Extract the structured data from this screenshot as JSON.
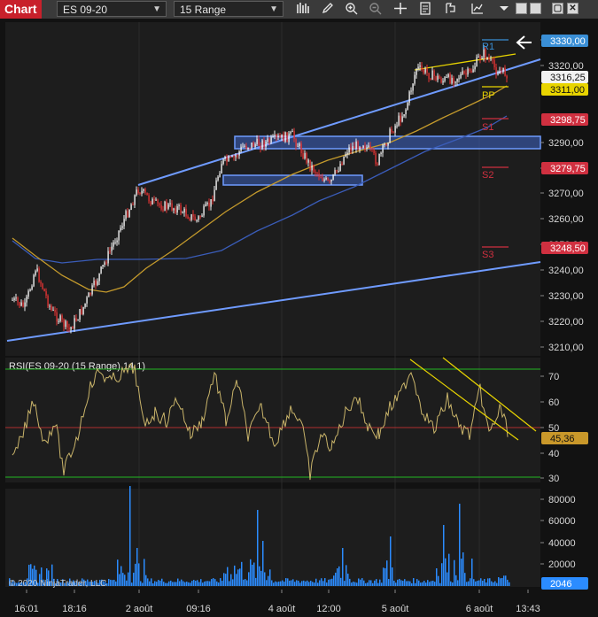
{
  "toolbar": {
    "title": "Chart",
    "instrument": "ES 09-20",
    "interval": "15 Range",
    "icons": [
      "bars-icon",
      "draw-pencil-icon",
      "zoom-in-icon",
      "zoom-out-icon",
      "crosshair-icon",
      "properties-icon",
      "strategy-icon",
      "indicator-icon",
      "menu-dropdown-icon",
      "window-minimize-icon",
      "window-restore-icon",
      "window-maximize-icon",
      "window-close-icon"
    ]
  },
  "price_panel": {
    "axis_ticks": [
      "3330,00",
      "3320,00",
      "3290,00",
      "3280,00",
      "3270,00",
      "3260,00",
      "3250,00",
      "3240,00",
      "3230,00",
      "3220,00",
      "3210,00"
    ],
    "badges": {
      "r1": "3330,00",
      "last": "3316,25",
      "pp": "3311,00",
      "s1": "3298,75",
      "s2": "3279,75",
      "s3": "3248,50"
    },
    "pivot_labels": {
      "r1": "R1",
      "pp": "PP",
      "s1": "S1",
      "s2": "S2",
      "s3": "S3"
    },
    "colors": {
      "candle_up": "#f0f0f0",
      "candle_down": "#e23434",
      "ma_slow": "#3a5cb8",
      "ma_fast": "#c49a2c",
      "trendline": "#6f9bff",
      "zone": "#3e65c7",
      "pivot_r": "#3a8fd6",
      "pivot_pp": "#e8d400",
      "pivot_s": "#d03040"
    }
  },
  "rsi_panel": {
    "label": "RSI(ES 09-20 (15 Range),14,1)",
    "axis_ticks": [
      "70",
      "60",
      "50",
      "40",
      "30"
    ],
    "badge": "45,36",
    "colors": {
      "line": "#c9b46a",
      "upper": "#22b822",
      "mid": "#b03030",
      "lower": "#22b822"
    }
  },
  "volume_panel": {
    "axis_ticks": [
      "80000",
      "60000",
      "40000",
      "20000"
    ],
    "badge": "2046",
    "copyright": "© 2020 NinjaTrader, LLC",
    "color": "#2b8cff"
  },
  "time_axis": {
    "labels": [
      "16:01",
      "18:16",
      "2 août",
      "09:16",
      "4 août",
      "12:00",
      "5 août",
      "6 août",
      "13:43"
    ]
  }
}
